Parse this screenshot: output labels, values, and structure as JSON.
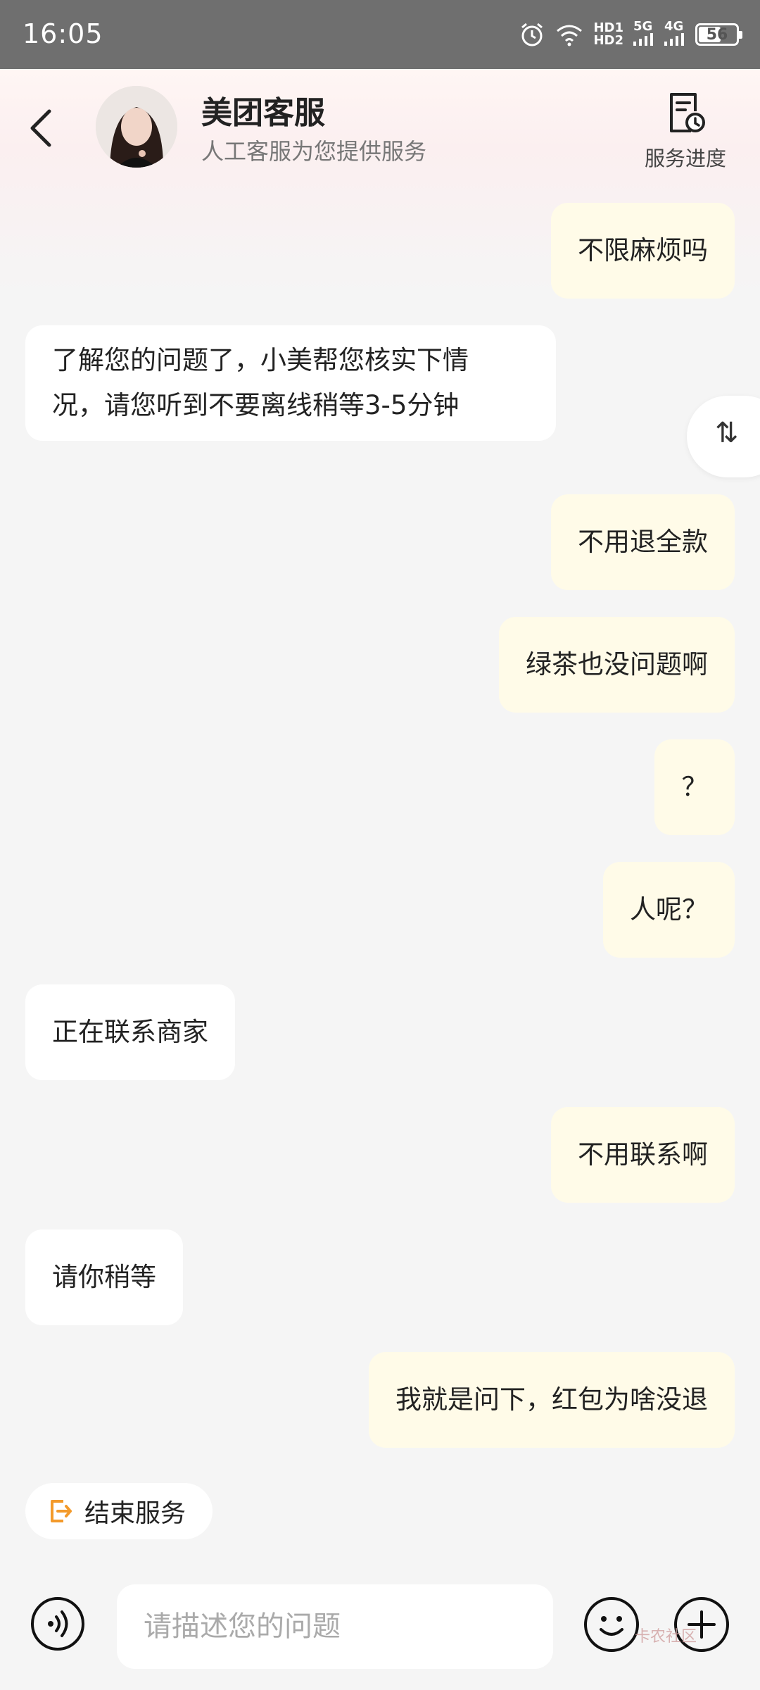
{
  "status_bar": {
    "time": "16:05",
    "hd1": "HD1",
    "hd2": "HD2",
    "net1": "5G",
    "net2": "4G",
    "battery": "56",
    "battery_fraction": 0.56
  },
  "header": {
    "title": "美团客服",
    "subtitle": "人工客服为您提供服务",
    "progress_label": "服务进度"
  },
  "messages": [
    {
      "sender": "me",
      "text": "不限麻烦吗"
    },
    {
      "sender": "agent",
      "text": "了解您的问题了，小美帮您核实下情\n况，请您听到不要离线稍等3-5分钟"
    },
    {
      "sender": "me",
      "text": "不用退全款"
    },
    {
      "sender": "me",
      "text": "绿茶也没问题啊"
    },
    {
      "sender": "me",
      "text": "？"
    },
    {
      "sender": "me",
      "text": "人呢？"
    },
    {
      "sender": "agent",
      "text": "正在联系商家"
    },
    {
      "sender": "me",
      "text": "不用联系啊"
    },
    {
      "sender": "agent",
      "text": "请你稍等"
    },
    {
      "sender": "me",
      "text": "我就是问下，红包为啥没退"
    }
  ],
  "scroll_handle": "⇅",
  "end_service_label": "结束服务",
  "input": {
    "placeholder": "请描述您的问题"
  },
  "watermark": "卡农社区",
  "colors": {
    "my_bubble": "#fffbe8",
    "agent_bubble": "#ffffff",
    "accent_orange": "#f39a2b"
  }
}
